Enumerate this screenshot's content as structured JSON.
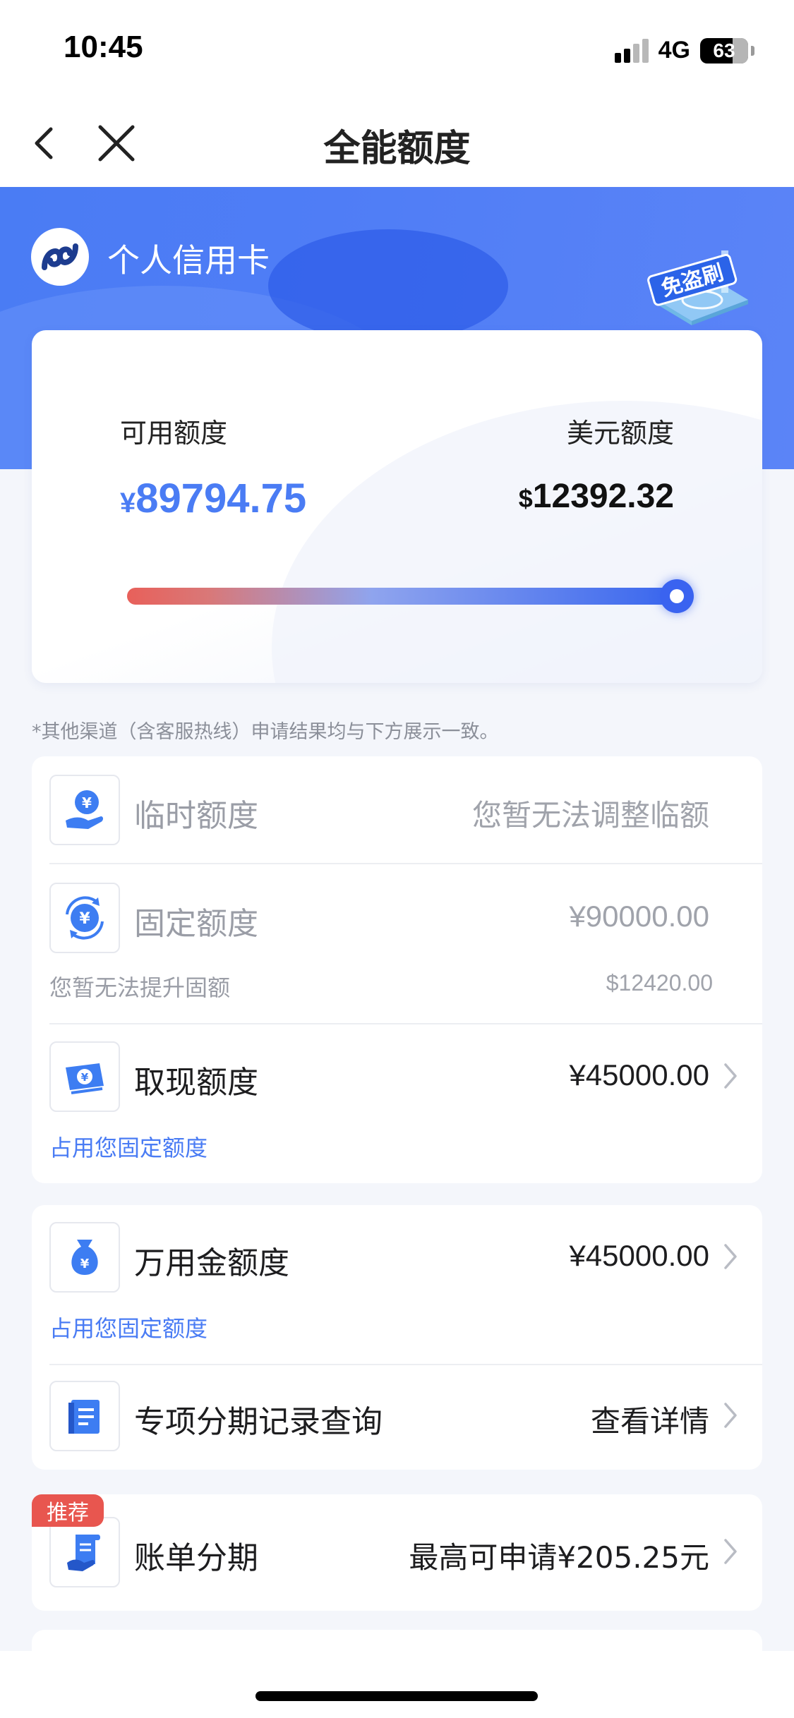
{
  "status_bar": {
    "time": "10:45",
    "network": "4G",
    "battery": "63"
  },
  "nav": {
    "title": "全能额度"
  },
  "hero": {
    "bank_name": "个人信用卡",
    "badge_text": "免盗刷"
  },
  "credit": {
    "available_label": "可用额度",
    "available_currency": "¥",
    "available_amount": "89794.75",
    "usd_label": "美元额度",
    "usd_currency": "$",
    "usd_amount": "12392.32",
    "usage_slider_level": 1.0
  },
  "disclaimer": "*其他渠道（含客服热线）申请结果均与下方展示一致。",
  "limits": {
    "temporary": {
      "title": "临时额度",
      "value": "您暂无法调整临额"
    },
    "fixed": {
      "title": "固定额度",
      "value": "¥90000.00",
      "sub": "您暂无法提升固额",
      "sub_value": "$12420.00"
    },
    "cash": {
      "title": "取现额度",
      "value": "¥45000.00",
      "sub": "占用您固定额度"
    }
  },
  "services": {
    "wanyongjin": {
      "title": "万用金额度",
      "value": "¥45000.00",
      "sub": "占用您固定额度"
    },
    "installment_records": {
      "title": "专项分期记录查询",
      "value": "查看详情"
    }
  },
  "bill_installment": {
    "tag": "推荐",
    "title": "账单分期",
    "value": "最高可申请¥205.25元"
  },
  "colors": {
    "accent": "#4a7cf4",
    "tag_red": "#e8564f",
    "slider_start": "#e8605a",
    "slider_end": "#3b68ee"
  }
}
